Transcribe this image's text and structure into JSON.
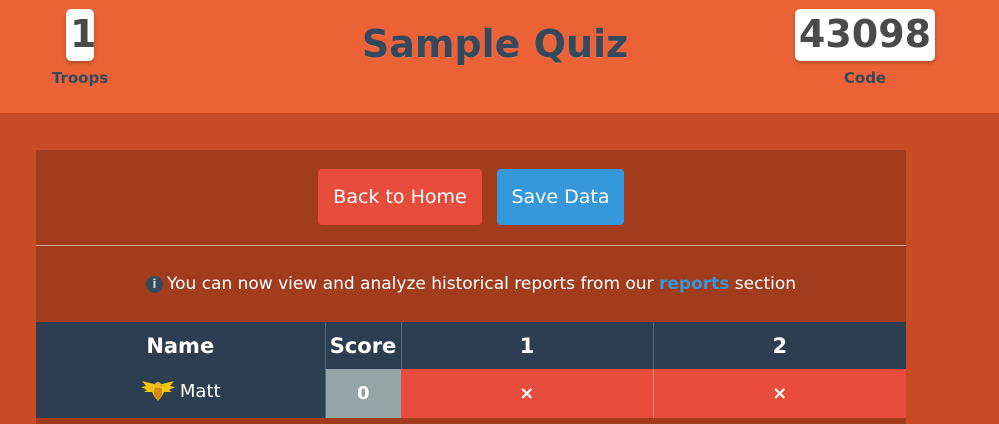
{
  "header": {
    "title": "Sample Quiz",
    "troops": {
      "value": "1",
      "label": "Troops"
    },
    "code": {
      "value": "43098",
      "label": "Code"
    }
  },
  "actions": {
    "back_label": "Back to Home",
    "save_label": "Save Data"
  },
  "notice": {
    "icon": "info-icon",
    "text_before": "You can now view and analyze historical reports from our",
    "link_text": "reports",
    "text_after": "section"
  },
  "table": {
    "headers": [
      "Name",
      "Score",
      "1",
      "2"
    ],
    "rows": [
      {
        "avatar": "eagle-icon",
        "name": "Matt",
        "score": "0",
        "answers": [
          "×",
          "×"
        ]
      }
    ]
  },
  "colors": {
    "header_bg": "#ea6235",
    "page_bg": "#c94b26",
    "panel_bg": "#a13c1c",
    "dark": "#2c3e50",
    "danger": "#e74c3c",
    "primary": "#3498db",
    "score_bg": "#95a5a6"
  }
}
